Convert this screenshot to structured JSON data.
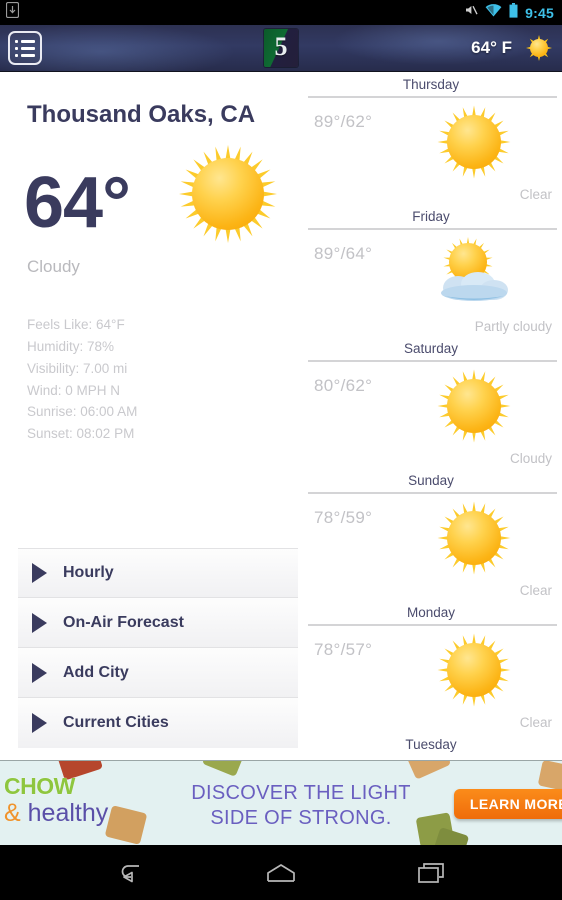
{
  "statusbar": {
    "time": "9:45",
    "icons": [
      "sd-card-icon",
      "mute-icon",
      "wifi-icon",
      "battery-icon"
    ]
  },
  "appbar": {
    "menu_icon": "list-menu-icon",
    "brand_logo_text": "5",
    "brand_logo_name": "channel-5-logo",
    "temperature": "64° F",
    "weather_icon": "sun-icon"
  },
  "current": {
    "city": "Thousand Oaks, CA",
    "temperature": "64°",
    "condition": "Cloudy",
    "icon": "sun-icon",
    "details": [
      "Feels Like:  64°F",
      "Humidity: 78%",
      "Visibility: 7.00 mi",
      "Wind: 0 MPH N",
      "Sunrise: 06:00 AM",
      "Sunset: 08:02 PM"
    ]
  },
  "menu": {
    "items": [
      {
        "label": "Hourly",
        "icon": "triangle-right-icon"
      },
      {
        "label": "On-Air Forecast",
        "icon": "triangle-right-icon"
      },
      {
        "label": "Add City",
        "icon": "triangle-right-icon"
      },
      {
        "label": "Current Cities",
        "icon": "triangle-right-icon"
      }
    ]
  },
  "forecast": {
    "days": [
      {
        "day": "Thursday",
        "high_low": "89°/62°",
        "condition": "Clear",
        "icon": "sun-icon"
      },
      {
        "day": "Friday",
        "high_low": "89°/64°",
        "condition": "Partly cloudy",
        "icon": "sun-behind-cloud-icon"
      },
      {
        "day": "Saturday",
        "high_low": "80°/62°",
        "condition": "Cloudy",
        "icon": "sun-icon"
      },
      {
        "day": "Sunday",
        "high_low": "78°/59°",
        "condition": "Clear",
        "icon": "sun-icon"
      },
      {
        "day": "Monday",
        "high_low": "78°/57°",
        "condition": "Clear",
        "icon": "sun-icon"
      }
    ],
    "next_day_partial": "Tuesday"
  },
  "ad": {
    "brand_line1": "CHOW",
    "brand_line2_amp": "&",
    "brand_line2": " healthy",
    "headline_line1": "DISCOVER THE LIGHT",
    "headline_line2": "SIDE OF STRONG.",
    "cta_label": "LEARN MORE"
  },
  "navbar": {
    "back": "back-icon",
    "home": "home-icon",
    "recents": "recent-apps-icon"
  },
  "colors": {
    "appbar_dark": "#2d3152",
    "text_navy": "#3a3b5e",
    "muted_gray": "#c2c2c6",
    "status_time": "#3ec0e8",
    "sun_yellow": "#fcb415",
    "ad_orange": "#ef6c0a",
    "ad_purple": "#6a5fc0",
    "ad_green": "#8ec63f"
  }
}
